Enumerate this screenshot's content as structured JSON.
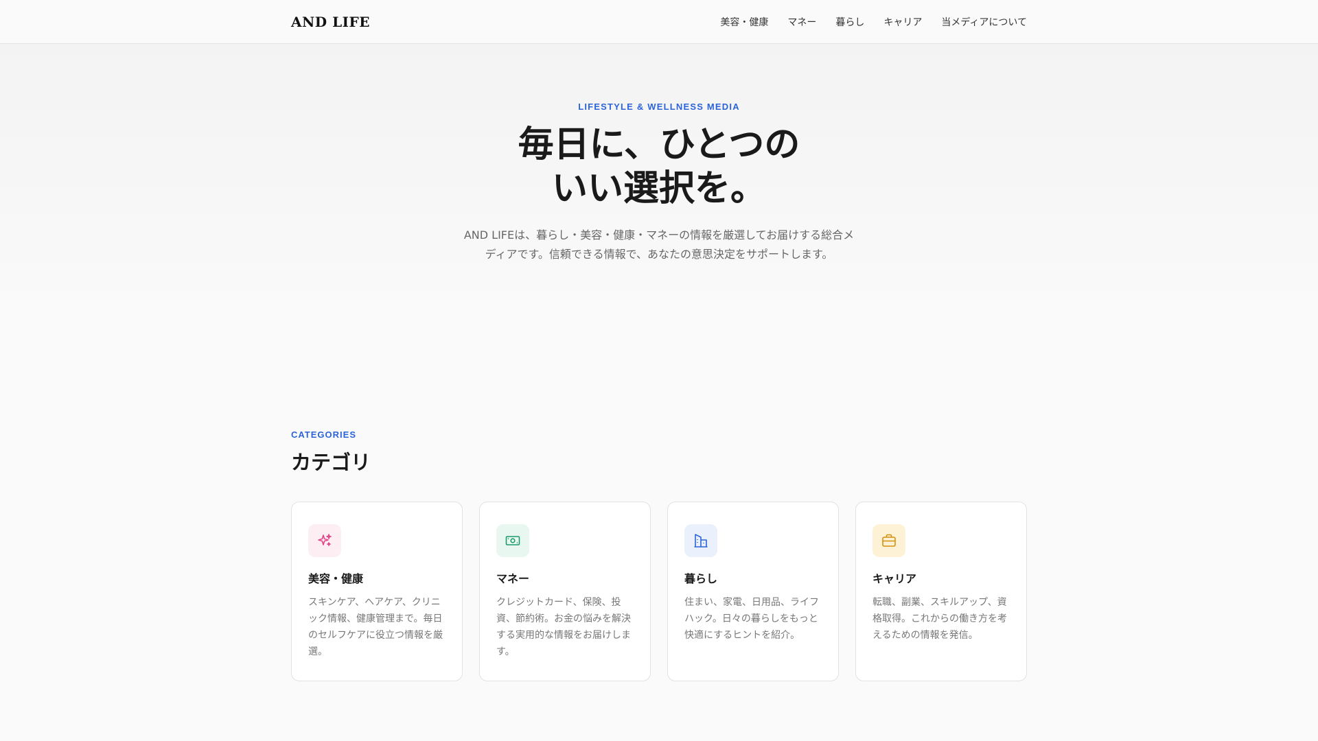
{
  "header": {
    "logo": "AND LIFE",
    "nav": [
      "美容・健康",
      "マネー",
      "暮らし",
      "キャリア",
      "当メディアについて"
    ]
  },
  "hero": {
    "eyebrow": "LIFESTYLE & WELLNESS MEDIA",
    "title_line1": "毎日に、ひとつの",
    "title_line2": "いい選択を。",
    "description": "AND LIFEは、暮らし・美容・健康・マネーの情報を厳選してお届けする総合メディアです。信頼できる情報で、あなたの意思決定をサポートします。"
  },
  "categories": {
    "eyebrow": "CATEGORIES",
    "title": "カテゴリ",
    "items": [
      {
        "icon": "sparkles-icon",
        "color": "#e0468a",
        "bg": "#fdeef4",
        "title": "美容・健康",
        "desc": "スキンケア、ヘアケア、クリニック情報、健康管理まで。毎日のセルフケアに役立つ情報を厳選。"
      },
      {
        "icon": "banknote-icon",
        "color": "#1a9c6c",
        "bg": "#e8f7f0",
        "title": "マネー",
        "desc": "クレジットカード、保険、投資、節約術。お金の悩みを解決する実用的な情報をお届けします。"
      },
      {
        "icon": "building-icon",
        "color": "#2b63d9",
        "bg": "#eaf1fd",
        "title": "暮らし",
        "desc": "住まい、家電、日用品、ライフハック。日々の暮らしをもっと快適にするヒントを紹介。"
      },
      {
        "icon": "briefcase-icon",
        "color": "#d4900f",
        "bg": "#fdf2d6",
        "title": "キャリア",
        "desc": "転職、副業、スキルアップ、資格取得。これからの働き方を考えるための情報を発信。"
      }
    ]
  }
}
